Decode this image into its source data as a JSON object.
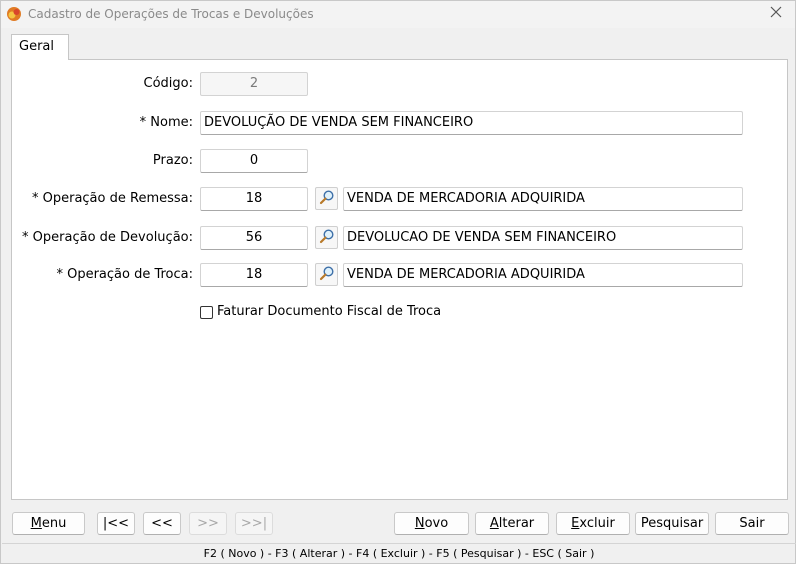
{
  "window": {
    "title": "Cadastro de Operações de Trocas e Devoluções"
  },
  "tabs": [
    {
      "label": "Geral",
      "active": true
    }
  ],
  "form": {
    "codigo": {
      "label": "Código:",
      "value": "2"
    },
    "nome": {
      "label": "* Nome:",
      "value": "DEVOLUÇÃO DE VENDA SEM FINANCEIRO"
    },
    "prazo": {
      "label": "Prazo:",
      "value": "0"
    },
    "operacao_remessa": {
      "label": "* Operação de Remessa:",
      "code": "18",
      "description": "VENDA DE MERCADORIA ADQUIRIDA"
    },
    "operacao_devolucao": {
      "label": "* Operação de Devolução:",
      "code": "56",
      "description": "DEVOLUCAO DE VENDA SEM FINANCEIRO"
    },
    "operacao_troca": {
      "label": "* Operação de Troca:",
      "code": "18",
      "description": "VENDA DE MERCADORIA ADQUIRIDA"
    },
    "faturar_checkbox": {
      "label": "Faturar Documento Fiscal de Troca",
      "checked": false
    }
  },
  "buttons": {
    "menu": {
      "hot": "M",
      "rest": "enu"
    },
    "first": "|<<",
    "prev": "<<",
    "next": ">>",
    "last": ">>|",
    "novo": {
      "hot": "N",
      "rest": "ovo"
    },
    "alterar": {
      "hot": "A",
      "rest": "lterar"
    },
    "excluir": {
      "hot": "E",
      "rest": "xcluir"
    },
    "pesquisar": "Pesquisar",
    "sair": "Sair"
  },
  "status_bar": "F2 ( Novo )  -  F3 ( Alterar )  -  F4 ( Excluir )  -  F5 ( Pesquisar )  -  ESC ( Sair )",
  "colors": {
    "accent": "#e07b24",
    "border": "#c6c6c6",
    "title_text": "#8a8a8a"
  },
  "icons": {
    "app": "app-logo-icon",
    "close": "close-icon",
    "lookup": "magnifier-icon"
  }
}
